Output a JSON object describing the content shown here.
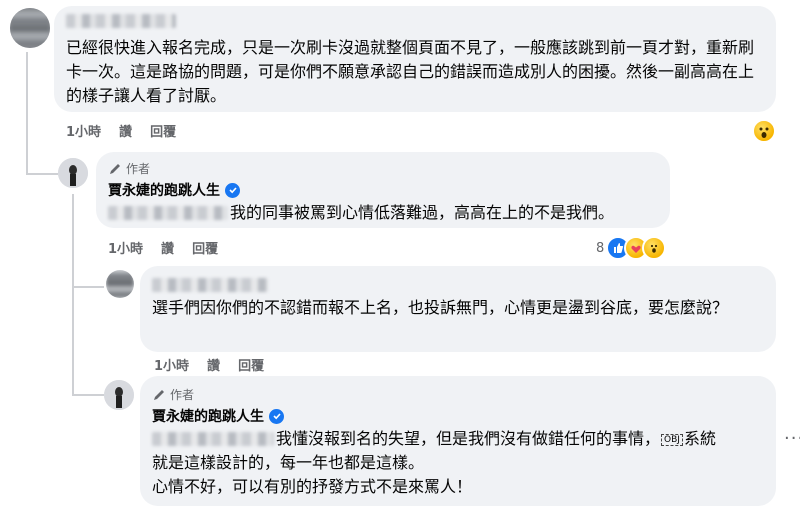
{
  "comments": [
    {
      "text": "已經很快進入報名完成，只是一次刷卡沒過就整個頁面不見了，一般應該跳到前一頁才對，重新刷卡一次。這是路協的問題，可是你們不願意承認自己的錯誤而造成別人的困擾。然後一副高高在上的樣子讓人看了討厭。",
      "time": "1小時",
      "like_label": "讚",
      "reply_label": "回覆",
      "reaction": "wow-emoji-icon"
    },
    {
      "author_tag": "作者",
      "author": "賈永婕的跑跳人生",
      "text": "我的同事被罵到心情低落難過，高高在上的不是我們。",
      "time": "1小時",
      "like_label": "讚",
      "reply_label": "回覆",
      "reaction_count": "8",
      "reactions": [
        "like-icon",
        "care-icon",
        "wow-icon"
      ]
    },
    {
      "text": "選手們因你們的不認錯而報不上名，也投訴無門，心情更是盪到谷底，要怎麼說？",
      "time": "1小時",
      "like_label": "讚",
      "reply_label": "回覆"
    },
    {
      "author_tag": "作者",
      "author": "賈永婕的跑跳人生",
      "text_line1": "我懂沒報到名的失望，但是我們沒有做錯任何的事情，",
      "tag_glyph": "OBJ",
      "text_line1_tail": "系統",
      "text_line2": "就是這樣設計的，每一年也都是這樣。",
      "text_line3": "心情不好，可以有別的抒發方式不是來罵人！"
    }
  ],
  "colors": {
    "bubble_bg": "#f0f2f5",
    "meta_text": "#65676b",
    "verified": "#1877f2",
    "like_blue": "#1877f2"
  }
}
